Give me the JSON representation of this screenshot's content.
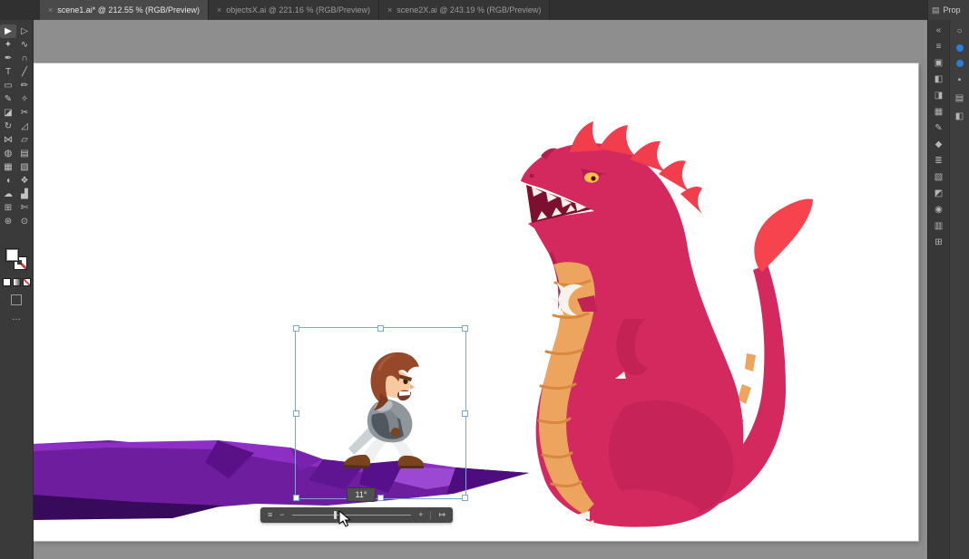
{
  "tabbar": {
    "close_glyph": "×",
    "tabs": [
      {
        "label": "scene1.ai* @ 212.55 % (RGB/Preview)",
        "active": true
      },
      {
        "label": "objectsX.ai @ 221.16 % (RGB/Preview)",
        "active": false
      },
      {
        "label": "scene2X.ai @ 243.19 % (RGB/Preview)",
        "active": false
      }
    ]
  },
  "toolbar": {
    "overflow_glyph": "…",
    "tools": [
      {
        "name": "selection-tool",
        "glyph": "▶"
      },
      {
        "name": "direct-selection-tool",
        "glyph": "▷"
      },
      {
        "name": "magic-wand-tool",
        "glyph": "✦"
      },
      {
        "name": "lasso-tool",
        "glyph": "∿"
      },
      {
        "name": "pen-tool",
        "glyph": "✒"
      },
      {
        "name": "curvature-tool",
        "glyph": "∩"
      },
      {
        "name": "type-tool",
        "glyph": "T"
      },
      {
        "name": "line-segment-tool",
        "glyph": "╱"
      },
      {
        "name": "rectangle-tool",
        "glyph": "▭"
      },
      {
        "name": "paintbrush-tool",
        "glyph": "✏"
      },
      {
        "name": "pencil-tool",
        "glyph": "✎"
      },
      {
        "name": "shaper-tool",
        "glyph": "✧"
      },
      {
        "name": "eraser-tool",
        "glyph": "◪"
      },
      {
        "name": "scissors-tool",
        "glyph": "✂"
      },
      {
        "name": "rotate-tool",
        "glyph": "↻"
      },
      {
        "name": "scale-tool",
        "glyph": "◿"
      },
      {
        "name": "width-tool",
        "glyph": "⋈"
      },
      {
        "name": "free-transform-tool",
        "glyph": "▱"
      },
      {
        "name": "shape-builder-tool",
        "glyph": "◍"
      },
      {
        "name": "perspective-grid-tool",
        "glyph": "▤"
      },
      {
        "name": "mesh-tool",
        "glyph": "▦"
      },
      {
        "name": "gradient-tool",
        "glyph": "▧"
      },
      {
        "name": "eyedropper-tool",
        "glyph": "◖"
      },
      {
        "name": "blend-tool",
        "glyph": "❖"
      },
      {
        "name": "symbol-sprayer-tool",
        "glyph": "☁"
      },
      {
        "name": "column-graph-tool",
        "glyph": "▟"
      },
      {
        "name": "artboard-tool",
        "glyph": "⊞"
      },
      {
        "name": "slice-tool",
        "glyph": "✄"
      },
      {
        "name": "hand-tool",
        "glyph": "⊛"
      },
      {
        "name": "zoom-tool",
        "glyph": "⊙"
      }
    ]
  },
  "right_dock": {
    "properties_title": "Prop",
    "panel_menu_glyph": "▤",
    "search_glyph": "○",
    "edge_glyphs": [
      "▪",
      "▤",
      "◧"
    ],
    "panel_icons": [
      {
        "name": "collapse-panels-icon",
        "glyph": "«"
      },
      {
        "name": "properties-panel-icon",
        "glyph": "≡"
      },
      {
        "name": "libraries-panel-icon",
        "glyph": "▣"
      },
      {
        "name": "color-panel-icon",
        "glyph": "◧"
      },
      {
        "name": "color-guide-icon",
        "glyph": "◨"
      },
      {
        "name": "swatches-panel-icon",
        "glyph": "▦"
      },
      {
        "name": "brushes-panel-icon",
        "glyph": "✎"
      },
      {
        "name": "symbols-panel-icon",
        "glyph": "◆"
      },
      {
        "name": "stroke-panel-icon",
        "glyph": "≣"
      },
      {
        "name": "gradient-panel-icon",
        "glyph": "▧"
      },
      {
        "name": "transparency-panel-icon",
        "glyph": "◩"
      },
      {
        "name": "appearance-panel-icon",
        "glyph": "◉"
      },
      {
        "name": "graphic-styles-panel-icon",
        "glyph": "▥"
      },
      {
        "name": "artboards-panel-icon",
        "glyph": "⊞"
      }
    ]
  },
  "selection": {
    "rotation_badge": "11°"
  },
  "hud": {
    "options_glyph": "≡",
    "minus_label": "−",
    "plus_label": "+",
    "tracker_glyph": "↦"
  },
  "colors": {
    "ui_dark": "#3a3a3a",
    "pasteboard_gray": "#8e8e8e",
    "artboard_white": "#ffffff",
    "selection_blue": "#7aa7d4",
    "toggle_blue": "#2e7cd6",
    "cliff_purple": "#6d1d9e",
    "dragon_crimson": "#d3295e",
    "dragon_crest_red": "#f23d4d",
    "dragon_belly_orange": "#eda45f",
    "knight_hair_auburn": "#96492a",
    "knight_armor_gray": "#8f969c"
  }
}
